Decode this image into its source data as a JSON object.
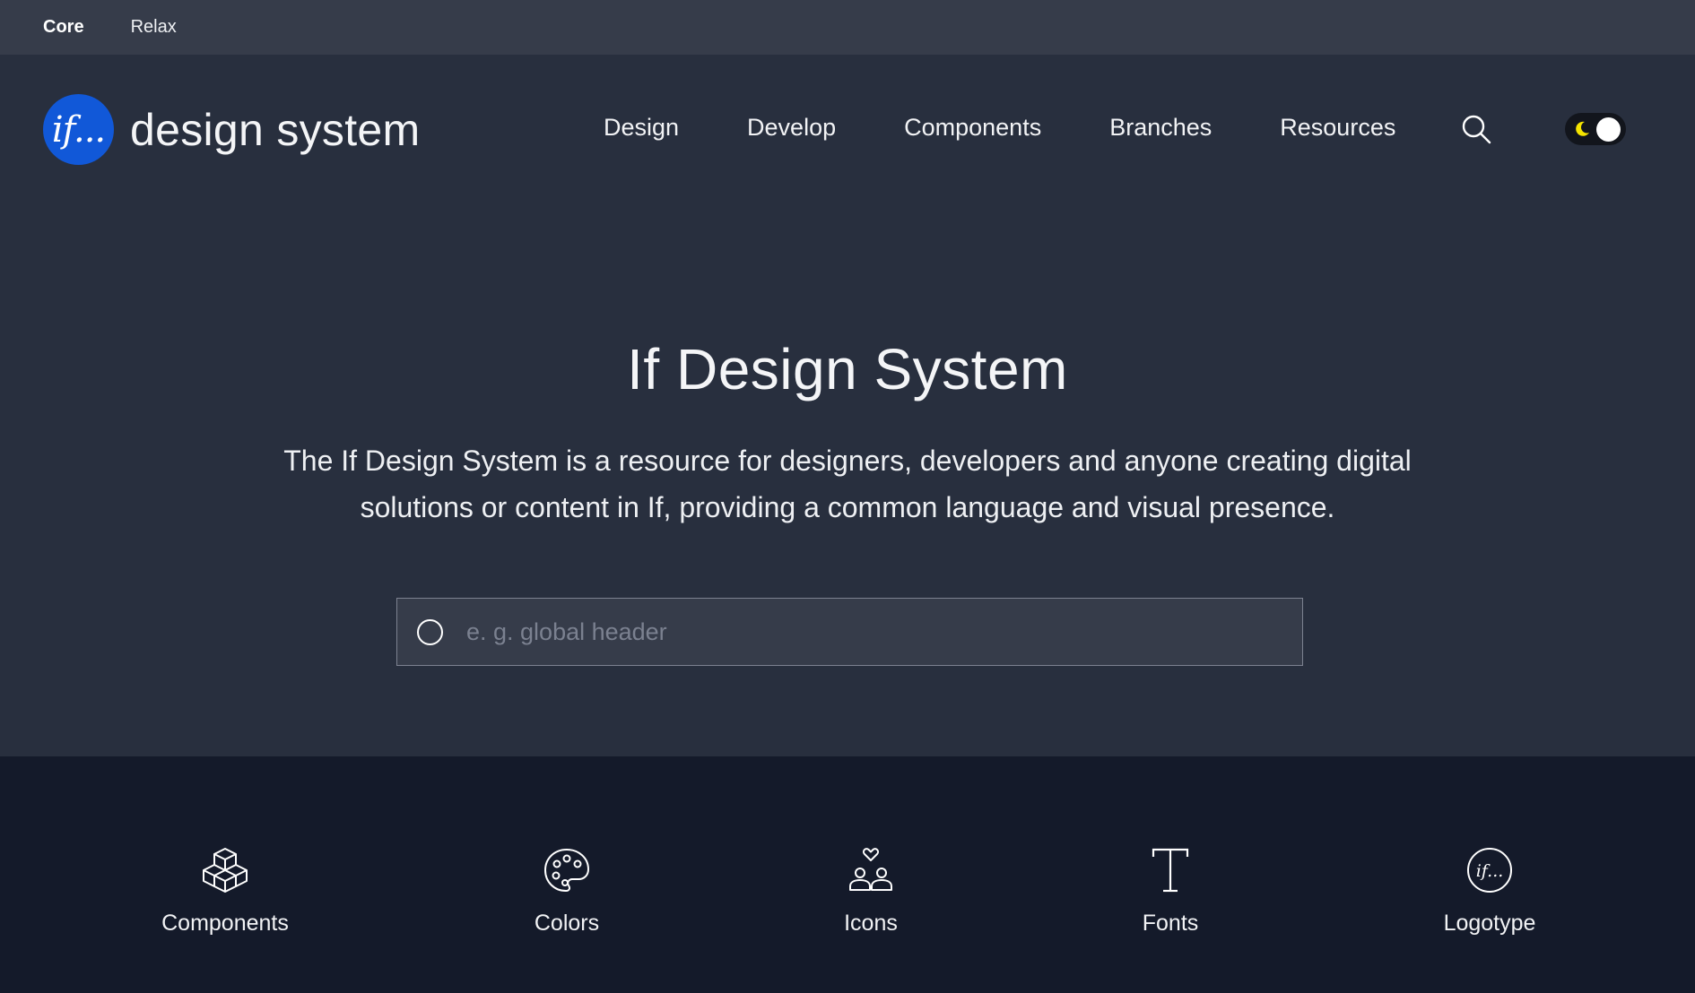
{
  "topbar": {
    "links": [
      {
        "label": "Core",
        "active": true
      },
      {
        "label": "Relax",
        "active": false
      }
    ]
  },
  "header": {
    "logo_mark": "if...",
    "logo_text": "design system",
    "nav": [
      "Design",
      "Develop",
      "Components",
      "Branches",
      "Resources"
    ],
    "search_icon": "search-icon",
    "theme_toggle": {
      "icon": "moon-icon",
      "state": "dark"
    }
  },
  "hero": {
    "title": "If Design System",
    "description": "The If Design System is a resource for designers, developers and anyone creating digital solutions or content in If, providing a common language and visual presence.",
    "search_placeholder": "e. g. global header"
  },
  "quick_links": [
    {
      "label": "Components",
      "icon": "cubes-icon"
    },
    {
      "label": "Colors",
      "icon": "palette-icon"
    },
    {
      "label": "Icons",
      "icon": "people-heart-icon"
    },
    {
      "label": "Fonts",
      "icon": "type-icon"
    },
    {
      "label": "Logotype",
      "icon": "if-logo-icon"
    }
  ],
  "colors": {
    "topbar_bg": "#363c4a",
    "page_bg": "#282f3e",
    "footer_bg": "#141a2a",
    "brand_blue": "#1158d8",
    "moon_yellow": "#f5e400"
  }
}
